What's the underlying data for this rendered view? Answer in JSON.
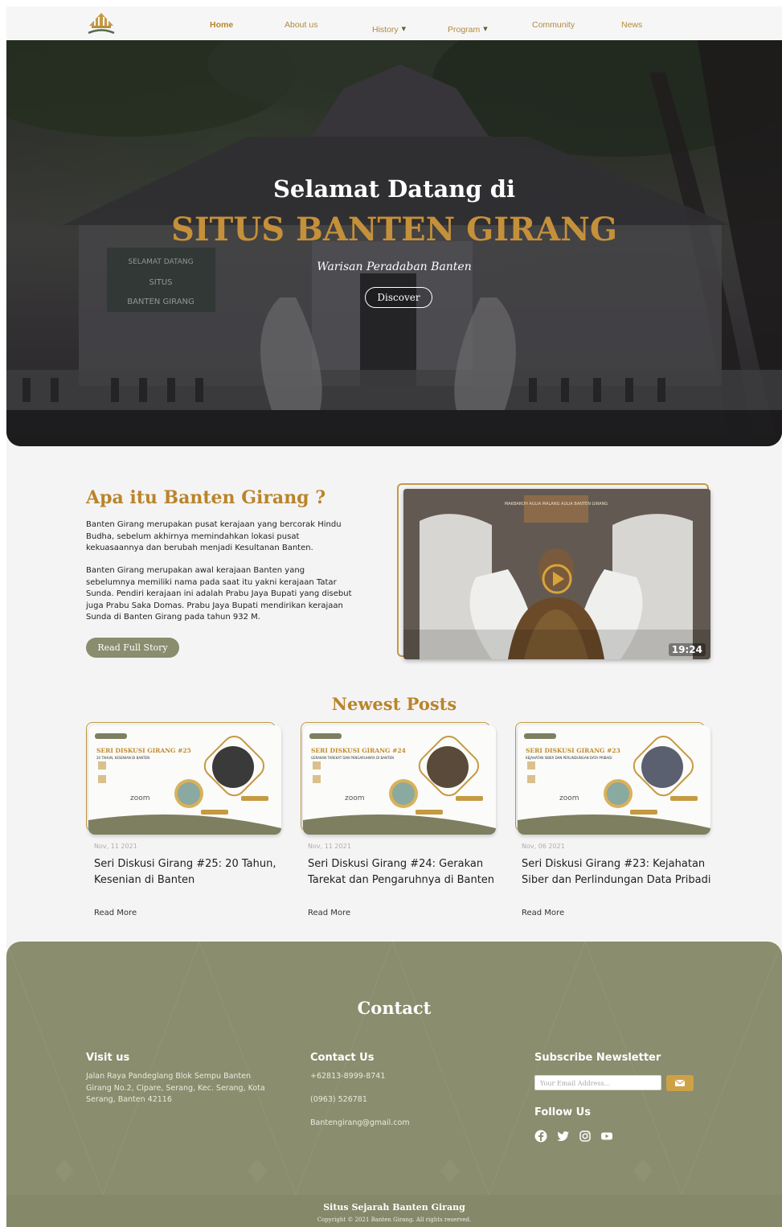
{
  "nav": {
    "items": [
      {
        "label": "Home",
        "active": true
      },
      {
        "label": "About us"
      },
      {
        "label": "History",
        "dropdown": true
      },
      {
        "label": "Program",
        "dropdown": true
      },
      {
        "label": "Community"
      },
      {
        "label": "News"
      }
    ],
    "caret": "▼"
  },
  "hero": {
    "title_line1": "Selamat Datang di",
    "title_line2": "SITUS BANTEN GIRANG",
    "subtitle": "Warisan Peradaban Banten",
    "button": "Discover",
    "sign_line1": "SELAMAT DATANG",
    "sign_line2": "SITUS",
    "sign_line3": "BANTEN GIRANG"
  },
  "about": {
    "title": "Apa itu Banten Girang ?",
    "paragraph1": "Banten Girang merupakan pusat kerajaan yang bercorak Hindu Budha, sebelum akhirnya memindahkan lokasi pusat kekuasaannya dan berubah menjadi Kesultanan Banten.",
    "paragraph2": "Banten Girang merupakan awal kerajaan Banten yang sebelumnya memiliki nama pada saat itu yakni kerajaan Tatar Sunda. Pendiri kerajaan ini adalah Prabu Jaya Bupati yang disebut juga Prabu Saka Domas. Prabu Jaya Bupati mendirikan kerajaan Sunda di Banten Girang pada tahun 932 M.",
    "button": "Read Full Story",
    "video_duration": "19:24",
    "video_sign": "MAKBAROH AULIA MALANG AULIA BANTEN GIRANG"
  },
  "posts": {
    "heading": "Newest Posts",
    "items": [
      {
        "thumb_title": "SERI DISKUSI GIRANG #25",
        "thumb_sub": "20 TAHUN, KESENIAN DI BANTEN",
        "date": "Nov, 11 2021",
        "title": "Seri Diskusi Girang #25: 20 Tahun, Kesenian di Banten",
        "read": "Read More",
        "zoom": "zoom"
      },
      {
        "thumb_title": "SERI DISKUSI GIRANG #24",
        "thumb_sub": "GERAKAN TAREKAT DAN PENGARUHNYA DI BANTEN",
        "date": "Nov, 11 2021",
        "title": "Seri Diskusi Girang #24: Gerakan Tarekat dan Pengaruhnya di Banten",
        "read": "Read More",
        "zoom": "zoom"
      },
      {
        "thumb_title": "SERI DISKUSI GIRANG #23",
        "thumb_sub": "KEJAHATAN SIBER DAN PERLINDUNGAN DATA PRIBADI",
        "date": "Nov, 06 2021",
        "title": "Seri Diskusi Girang #23: Kejahatan Siber dan Perlindungan Data Pribadi",
        "read": "Read More",
        "zoom": "zoom"
      }
    ]
  },
  "footer": {
    "title": "Contact",
    "visit": {
      "heading": "Visit us",
      "address": "Jalan Raya Pandeglang Blok Sempu Banten Girang No.2, Cipare, Serang, Kec. Serang, Kota Serang, Banten 42116"
    },
    "contact": {
      "heading": "Contact Us",
      "phone1": "+62813-8999-8741",
      "phone2": "(0963) 526781",
      "email": "Bantengirang@gmail.com"
    },
    "newsletter": {
      "heading": "Subscribe Newsletter",
      "placeholder": "Your Email Address..."
    },
    "follow": {
      "heading": "Follow Us",
      "icons": [
        "facebook-icon",
        "twitter-icon",
        "instagram-icon",
        "youtube-icon"
      ]
    },
    "brand": "Situs Sejarah Banten Girang",
    "copyright": "Copyright © 2021 Banten Girang. All rights reserved."
  },
  "colors": {
    "gold": "#b9852a",
    "olive": "#8a8d6e",
    "background": "#f5f4f5"
  }
}
